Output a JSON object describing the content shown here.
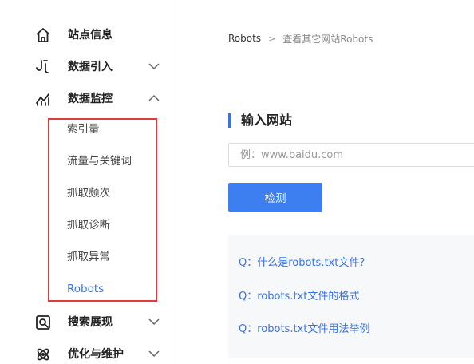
{
  "sidebar": {
    "items": [
      {
        "label": "站点信息",
        "icon": "home-icon"
      },
      {
        "label": "数据引入",
        "icon": "data-import-icon",
        "expanded": false
      },
      {
        "label": "数据监控",
        "icon": "monitor-chart-icon",
        "expanded": true
      },
      {
        "label": "搜索展现",
        "icon": "search-display-icon",
        "expanded": false
      },
      {
        "label": "优化与维护",
        "icon": "optimize-atom-icon",
        "expanded": false
      }
    ],
    "sub_items": [
      "索引量",
      "流量与关键词",
      "抓取频次",
      "抓取诊断",
      "抓取异常",
      "Robots"
    ],
    "active_sub": "Robots"
  },
  "breadcrumb": {
    "root": "Robots",
    "separator": ">",
    "current": "查看其它网站Robots"
  },
  "main": {
    "title": "输入网站",
    "input_placeholder": "例：www.baidu.com",
    "input_value": "",
    "check_button": "检测",
    "faq": [
      "Q：什么是robots.txt文件?",
      "Q：robots.txt文件的格式",
      "Q：robots.txt文件用法举例"
    ]
  },
  "colors": {
    "accent": "#3a73e6",
    "button": "#3d7ef0",
    "highlight_box": "#e03b3b",
    "faq_bg": "#f7f8fa"
  }
}
